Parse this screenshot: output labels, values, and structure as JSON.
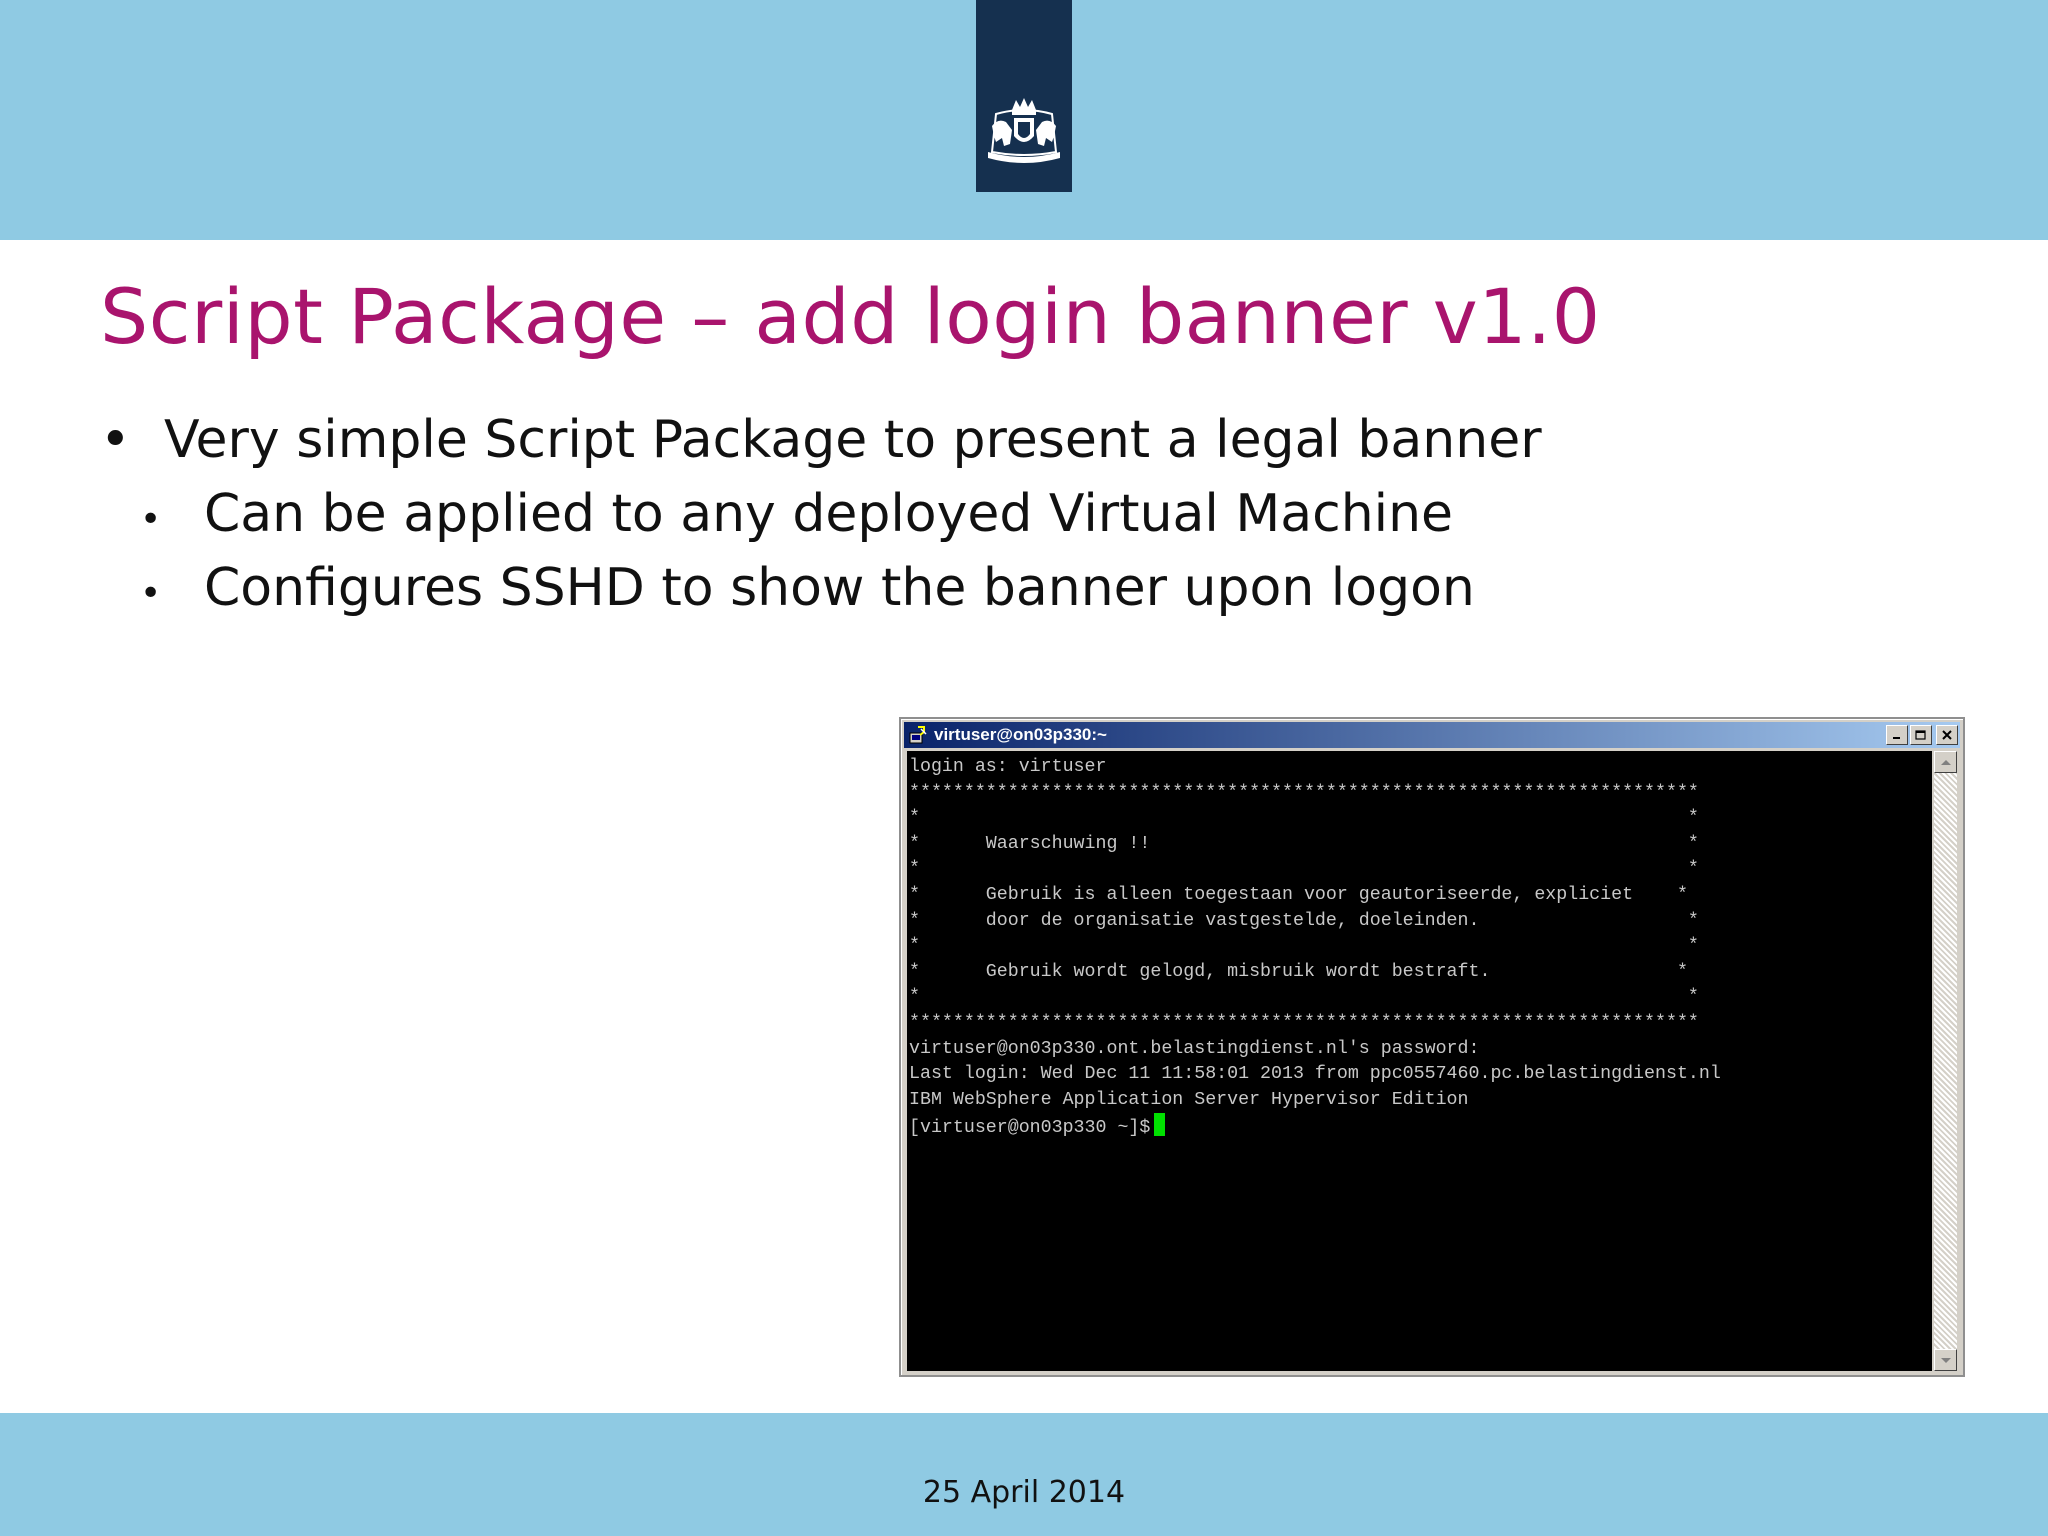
{
  "slide": {
    "title": "Script Package – add login banner v1.0",
    "bullets": [
      {
        "text": "Very simple Script Package to present a legal banner",
        "level": 1
      },
      {
        "text": "Can be applied to any deployed Virtual Machine",
        "level": 2
      },
      {
        "text": "Configures SSHD to show the banner upon logon",
        "level": 2
      }
    ],
    "footer_date": "25 April 2014",
    "logo_icon": "royal-coat-of-arms-icon"
  },
  "colors": {
    "band": "#8fcae3",
    "logo_ribbon": "#15304f",
    "title": "#a9146d",
    "cursor": "#00e000"
  },
  "terminal": {
    "window_title": "virtuser@on03p330:~",
    "window_buttons": [
      "minimize",
      "maximize",
      "close"
    ],
    "lines": [
      "login as: virtuser",
      "************************************************************************",
      "*                                                                      *",
      "*      Waarschuwing !!                                                 *",
      "*                                                                      *",
      "*      Gebruik is alleen toegestaan voor geautoriseerde, expliciet    *",
      "*      door de organisatie vastgestelde, doeleinden.                   *",
      "*                                                                      *",
      "*      Gebruik wordt gelogd, misbruik wordt bestraft.                 *",
      "*                                                                      *",
      "************************************************************************",
      "virtuser@on03p330.ont.belastingdienst.nl's password:",
      "Last login: Wed Dec 11 11:58:01 2013 from ppc0557460.pc.belastingdienst.nl",
      "IBM WebSphere Application Server Hypervisor Edition"
    ],
    "prompt": "[virtuser@on03p330 ~]$"
  }
}
